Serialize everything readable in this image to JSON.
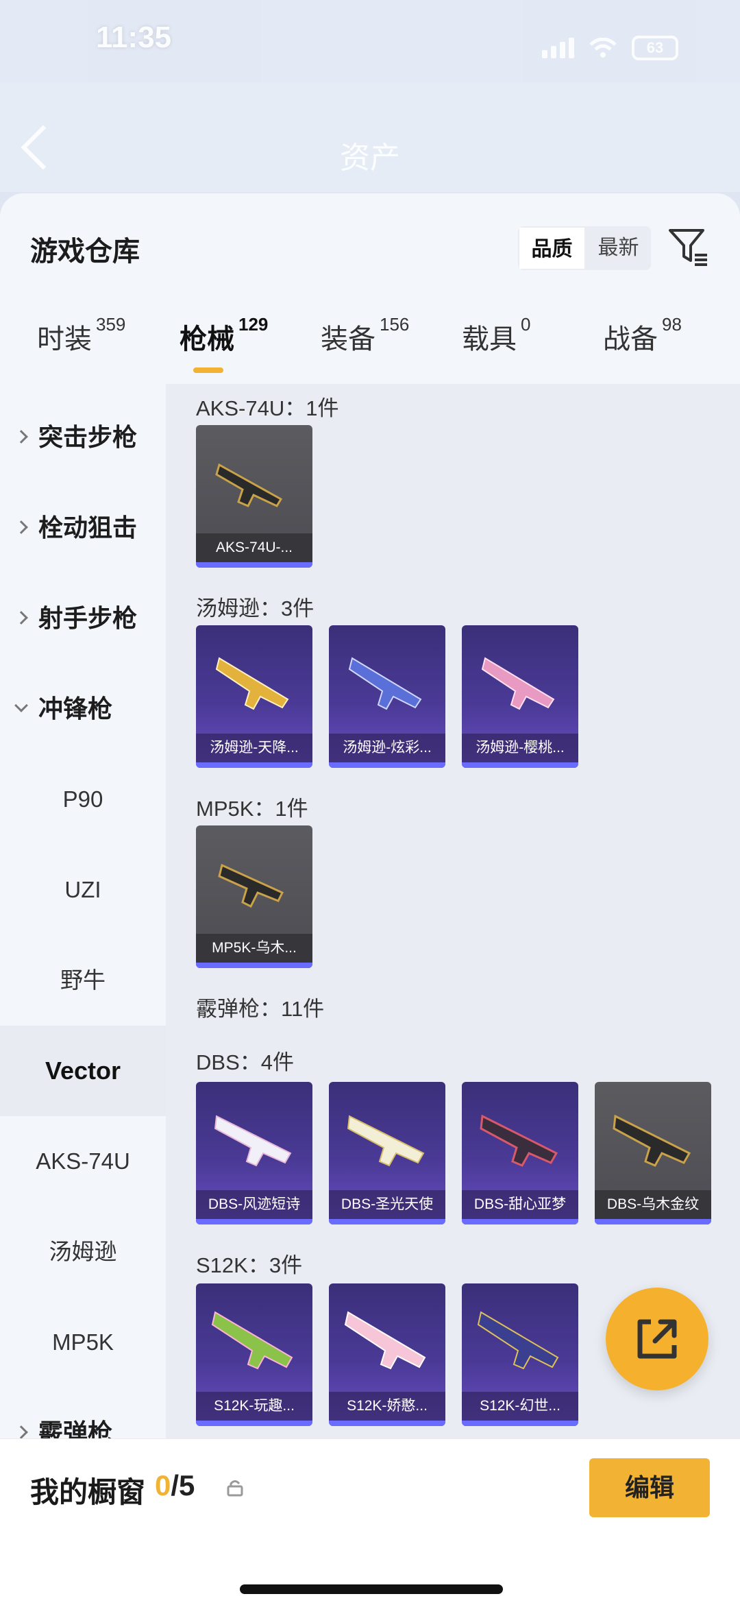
{
  "status": {
    "time": "11:35",
    "battery": "63"
  },
  "header": {
    "title": "资产"
  },
  "warehouse": {
    "title": "游戏仓库",
    "sort": [
      "品质",
      "最新"
    ]
  },
  "tabs": [
    {
      "label": "时装",
      "count": "359"
    },
    {
      "label": "枪械",
      "count": "129"
    },
    {
      "label": "装备",
      "count": "156"
    },
    {
      "label": "载具",
      "count": "0"
    },
    {
      "label": "战备",
      "count": "98"
    }
  ],
  "sidebar": [
    {
      "label": "突击步枪"
    },
    {
      "label": "栓动狙击"
    },
    {
      "label": "射手步枪"
    },
    {
      "label": "冲锋枪"
    },
    {
      "label": "P90"
    },
    {
      "label": "UZI"
    },
    {
      "label": "野牛"
    },
    {
      "label": "Vector"
    },
    {
      "label": "AKS-74U"
    },
    {
      "label": "汤姆逊"
    },
    {
      "label": "MP5K"
    },
    {
      "label": "霰弹枪"
    }
  ],
  "groups": [
    {
      "title": "AKS-74U：1件",
      "items": [
        {
          "label": "AKS-74U-..."
        }
      ]
    },
    {
      "title": "汤姆逊：3件",
      "items": [
        {
          "label": "汤姆逊-天降..."
        },
        {
          "label": "汤姆逊-炫彩..."
        },
        {
          "label": "汤姆逊-樱桃..."
        }
      ]
    },
    {
      "title": "MP5K：1件",
      "items": [
        {
          "label": "MP5K-乌木..."
        }
      ]
    },
    {
      "title": "霰弹枪：11件"
    },
    {
      "title": "DBS：4件",
      "items": [
        {
          "label": "DBS-风迹短诗"
        },
        {
          "label": "DBS-圣光天使"
        },
        {
          "label": "DBS-甜心亚梦"
        },
        {
          "label": "DBS-乌木金纹"
        }
      ]
    },
    {
      "title": "S12K：3件",
      "items": [
        {
          "label": "S12K-玩趣..."
        },
        {
          "label": "S12K-娇憨..."
        },
        {
          "label": "S12K-幻世..."
        }
      ]
    }
  ],
  "showcase": {
    "label": "我的橱窗",
    "used": "0",
    "total": "/5",
    "edit": "编辑"
  },
  "colors": {
    "accent": "#f2b233",
    "rare_bar": "#6a6cff"
  }
}
